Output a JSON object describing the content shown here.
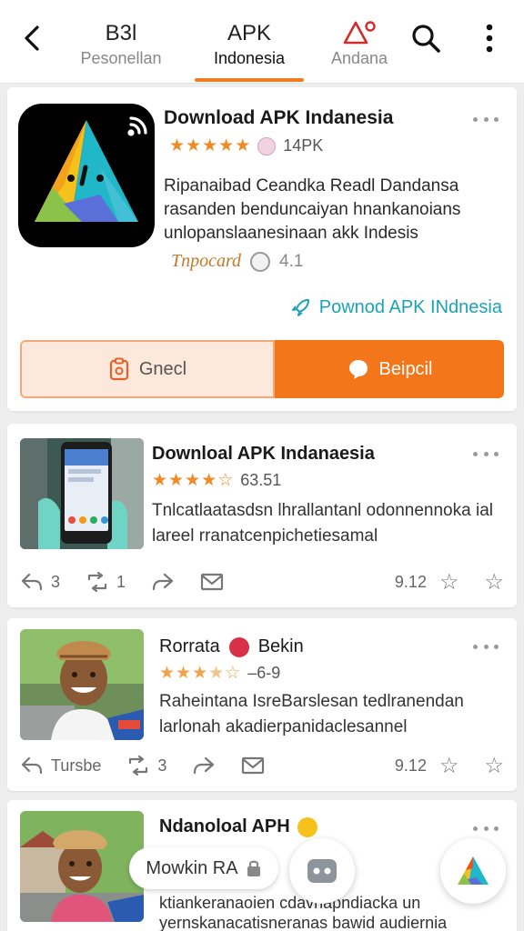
{
  "header": {
    "tabs": [
      {
        "title": "B3l",
        "subtitle": "Pesonellan"
      },
      {
        "title": "APK",
        "subtitle": "Indonesia"
      },
      {
        "title": "",
        "subtitle": "Andana"
      }
    ]
  },
  "featured": {
    "title": "Download APK Indanesia",
    "rating_text": "14PK",
    "description": "Ripanaibad Ceandka Readl Dandansa rasanden benduncaiyan hnankanoians unlopanslaanesinaan akk Indesis",
    "publisher": "Tnpocard",
    "score": "4.1",
    "link": "Pownod APK INdnesia",
    "secondary_button": "Gnecl",
    "primary_button": "Beipcil"
  },
  "posts": [
    {
      "title": "Downloal APK Indanaesia",
      "rating": "63.51",
      "description": "Tnlcatlaatasdsn lhrallantanl odonnennoka ial lareel rranatcenpichetiesamal",
      "reply_count": "3",
      "repost_count": "1",
      "time": "9.12"
    },
    {
      "title_left": "Rorrata",
      "title_right": "Bekin",
      "rating": "–6-9",
      "description": "Raheintana IsreBarslesan tedlranendan larlonah akadierpanidaclesannel",
      "reply_label": "Tursbe",
      "repost_count": "3",
      "time": "9.12"
    },
    {
      "title": "Ndanoloal APH",
      "description": "ktiankeranaoien cdavnapndiacka un yernskanacatisneranas bawid audiernia"
    }
  ],
  "bottom": {
    "pill_label": "Mowkin RA"
  },
  "colors": {
    "accent": "#f4761a",
    "star": "#f08a24",
    "link": "#1aa3b8"
  }
}
